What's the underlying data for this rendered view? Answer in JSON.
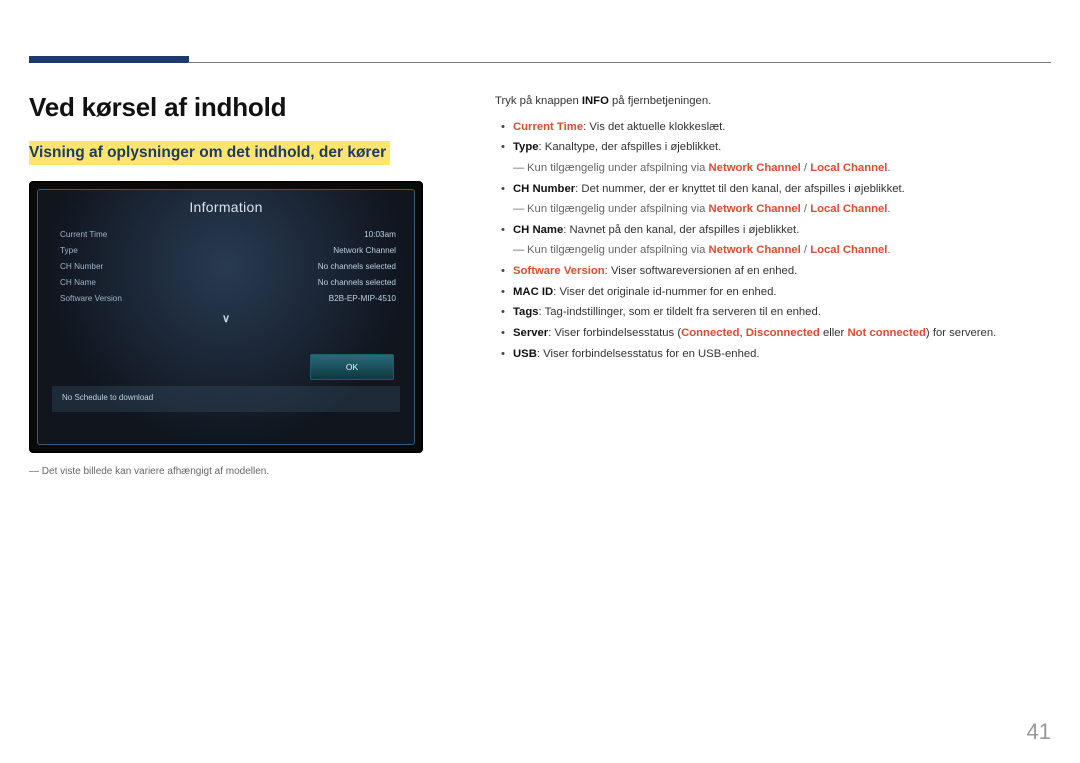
{
  "page_number": "41",
  "heading1": "Ved kørsel af indhold",
  "heading2": "Visning af oplysninger om det indhold, der kører",
  "footnote": "Det viste billede kan variere afhængigt af modellen.",
  "screenshot": {
    "title": "Information",
    "rows": [
      {
        "label": "Current Time",
        "value": "10:03am"
      },
      {
        "label": "Type",
        "value": "Network Channel"
      },
      {
        "label": "CH Number",
        "value": "No channels selected"
      },
      {
        "label": "CH Name",
        "value": "No channels selected"
      },
      {
        "label": "Software Version",
        "value": "B2B-EP-MIP-4510"
      }
    ],
    "arrow": "∨",
    "ok": "OK",
    "schedule": "No Schedule to download"
  },
  "intro": {
    "pre": "Tryk på knappen ",
    "bold": "INFO",
    "post": " på fjernbetjeningen."
  },
  "bullets": {
    "current_time": {
      "label": "Current Time",
      "text": ": Vis det aktuelle klokkeslæt."
    },
    "type": {
      "label": "Type",
      "text": ": Kanaltype, der afspilles i øjeblikket."
    },
    "note_nc_lc": {
      "pre": "Kun tilgængelig under afspilning via ",
      "nc": "Network Channel",
      "sep": " / ",
      "lc": "Local Channel",
      "post": "."
    },
    "ch_number": {
      "label": "CH Number",
      "text": ": Det nummer, der er knyttet til den kanal, der afspilles i øjeblikket."
    },
    "ch_name": {
      "label": "CH Name",
      "text": ": Navnet på den kanal, der afspilles i øjeblikket."
    },
    "sw_version": {
      "label": "Software Version",
      "text": ": Viser softwareversionen af en enhed."
    },
    "mac_id": {
      "label": "MAC ID",
      "text": ": Viser det originale id-nummer for en enhed."
    },
    "tags": {
      "label": "Tags",
      "text": ": Tag-indstillinger, som er tildelt fra serveren til en enhed."
    },
    "server": {
      "label": "Server",
      "pre": ": Viser forbindelsesstatus (",
      "c": "Connected",
      "s1": ", ",
      "d": "Disconnected",
      "s2": " eller ",
      "n": "Not connected",
      "post": ") for serveren."
    },
    "usb": {
      "label": "USB",
      "text": ": Viser forbindelsesstatus for en USB-enhed."
    }
  }
}
